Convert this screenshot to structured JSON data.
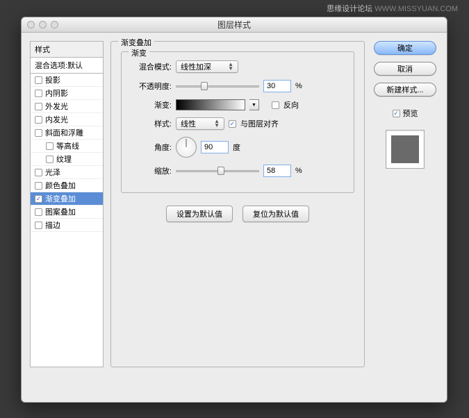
{
  "watermark": {
    "text1": "思缘设计论坛",
    "text2": " WWW.MISSYUAN.COM"
  },
  "window": {
    "title": "图层样式"
  },
  "styles": {
    "header": "样式",
    "blending": "混合选项:默认",
    "items": [
      {
        "label": "投影",
        "checked": false,
        "indent": false
      },
      {
        "label": "内阴影",
        "checked": false,
        "indent": false
      },
      {
        "label": "外发光",
        "checked": false,
        "indent": false
      },
      {
        "label": "内发光",
        "checked": false,
        "indent": false
      },
      {
        "label": "斜面和浮雕",
        "checked": false,
        "indent": false
      },
      {
        "label": "等高线",
        "checked": false,
        "indent": true
      },
      {
        "label": "纹理",
        "checked": false,
        "indent": true
      },
      {
        "label": "光泽",
        "checked": false,
        "indent": false
      },
      {
        "label": "颜色叠加",
        "checked": false,
        "indent": false
      },
      {
        "label": "渐变叠加",
        "checked": true,
        "indent": false,
        "selected": true
      },
      {
        "label": "图案叠加",
        "checked": false,
        "indent": false
      },
      {
        "label": "描边",
        "checked": false,
        "indent": false
      }
    ]
  },
  "settings": {
    "group_title": "渐变叠加",
    "subgroup_title": "渐变",
    "blend_mode": {
      "label": "混合模式:",
      "value": "线性加深"
    },
    "opacity": {
      "label": "不透明度:",
      "value": "30",
      "unit": "%"
    },
    "gradient": {
      "label": "渐变:",
      "reverse_label": "反向",
      "reverse_checked": false
    },
    "style": {
      "label": "样式:",
      "value": "线性",
      "align_label": "与图层对齐",
      "align_checked": true
    },
    "angle": {
      "label": "角度:",
      "value": "90",
      "unit": "度"
    },
    "scale": {
      "label": "缩放:",
      "value": "58",
      "unit": "%"
    },
    "buttons": {
      "make_default": "设置为默认值",
      "reset_default": "复位为默认值"
    }
  },
  "actions": {
    "ok": "确定",
    "cancel": "取消",
    "new_style": "新建样式...",
    "preview_label": "预览",
    "preview_checked": true
  }
}
